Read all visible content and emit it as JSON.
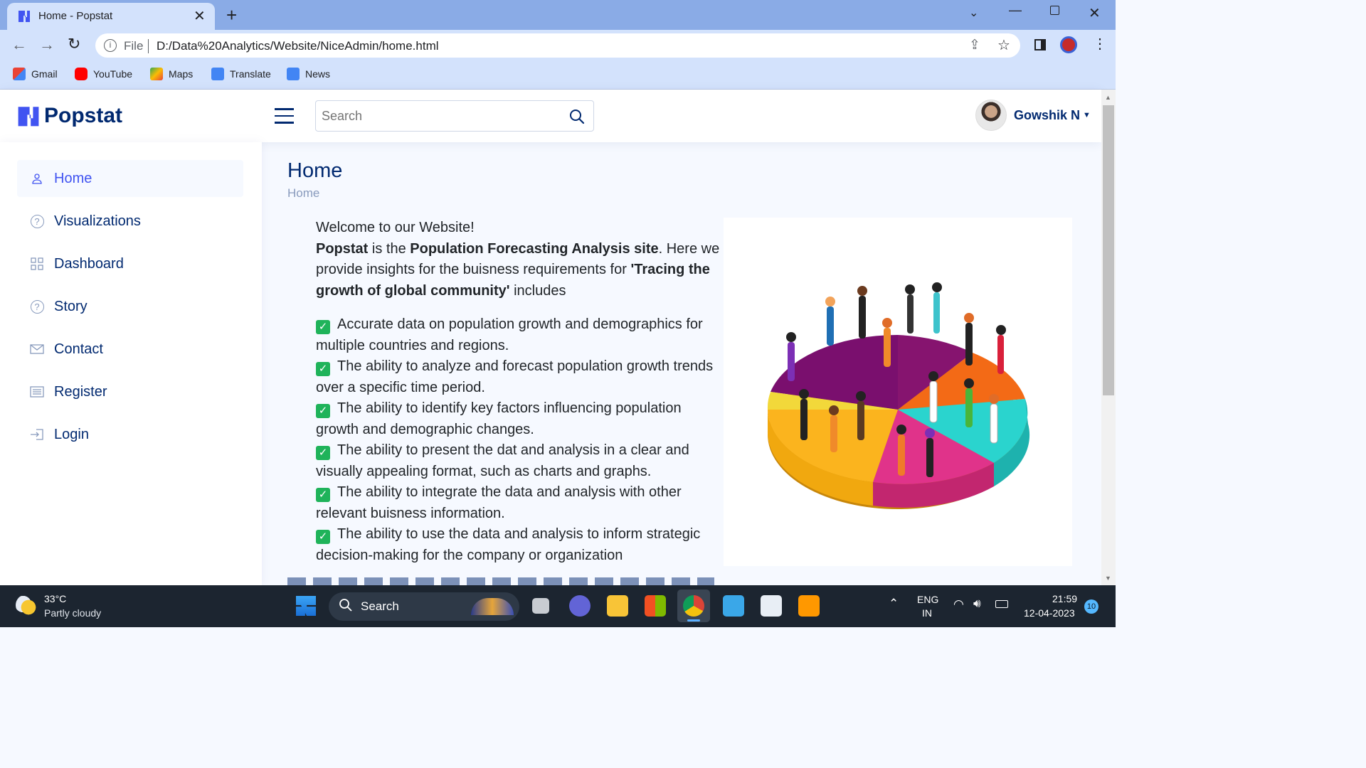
{
  "browser": {
    "tab_title": "Home - Popstat",
    "url_scheme": "File",
    "url": "D:/Data%20Analytics/Website/NiceAdmin/home.html",
    "bookmarks": [
      "Gmail",
      "YouTube",
      "Maps",
      "Translate",
      "News"
    ]
  },
  "app": {
    "logo_text": "Popstat",
    "search_placeholder": "Search",
    "user_name": "Gowshik N"
  },
  "sidebar": {
    "items": [
      {
        "label": "Home",
        "icon": "person-icon",
        "active": true
      },
      {
        "label": "Visualizations",
        "icon": "question-circle-icon"
      },
      {
        "label": "Dashboard",
        "icon": "grid-icon"
      },
      {
        "label": "Story",
        "icon": "question-circle-icon"
      },
      {
        "label": "Contact",
        "icon": "envelope-icon"
      },
      {
        "label": "Register",
        "icon": "card-list-icon"
      },
      {
        "label": "Login",
        "icon": "box-arrow-in-right-icon"
      }
    ]
  },
  "page": {
    "title": "Home",
    "breadcrumb": "Home",
    "welcome": "Welcome to our Website!",
    "intro_brand": "Popstat",
    "intro_1": " is the ",
    "intro_bold_site": "Population Forecasting Analysis site",
    "intro_2": ". Here we provide insights for the buisness requirements for ",
    "intro_bold_quote": "'Tracing the growth of global community'",
    "intro_3": " includes",
    "bullets": [
      "Accurate data on population growth and demographics for multiple countries and regions.",
      "The ability to analyze and forecast population growth trends over a specific time period.",
      "The ability to identify key factors influencing population growth and demographic changes.",
      "The ability to present the dat and analysis in a clear and visually appealing format, such as charts and graphs.",
      "The ability to integrate the data and analysis with other relevant buisness information.",
      "The ability to use the data and analysis to inform strategic decision-making for the company or organization"
    ]
  },
  "taskbar": {
    "temperature": "33°C",
    "weather": "Partly cloudy",
    "search": "Search",
    "lang_1": "ENG",
    "lang_2": "IN",
    "time": "21:59",
    "date": "12-04-2023",
    "notifications": "10"
  },
  "colors": {
    "brand": "#012970",
    "accent": "#4154f1",
    "chrome_tabbar": "#8aabe6",
    "chrome_toolbar": "#d3e2fc",
    "check_green": "#1fb35a"
  }
}
